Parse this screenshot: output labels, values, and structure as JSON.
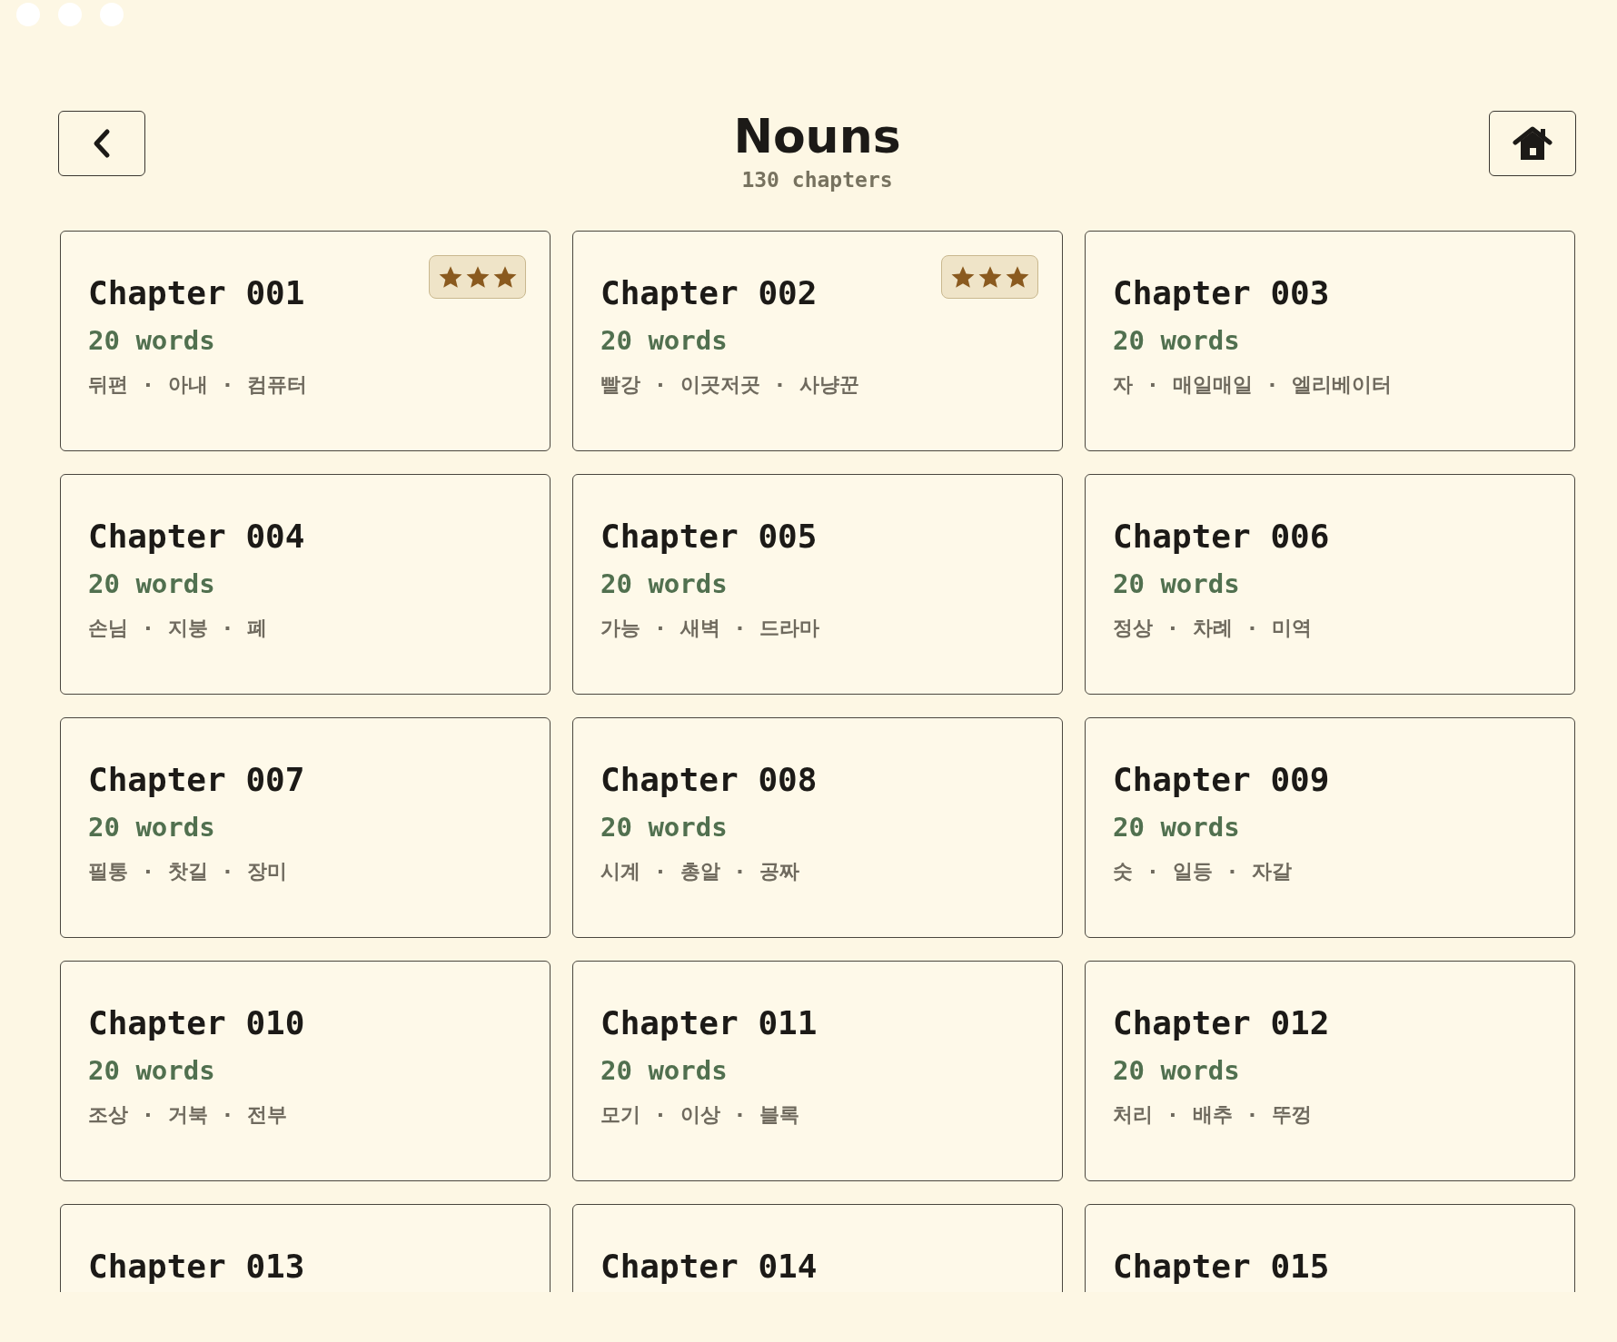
{
  "header": {
    "title": "Nouns",
    "subtitle": "130 chapters"
  },
  "chapters": [
    {
      "title": "Chapter 001",
      "count": "20 words",
      "preview": "뒤편 · 아내 · 컴퓨터",
      "stars": 3
    },
    {
      "title": "Chapter 002",
      "count": "20 words",
      "preview": "빨강 · 이곳저곳 · 사냥꾼",
      "stars": 3
    },
    {
      "title": "Chapter 003",
      "count": "20 words",
      "preview": "자 · 매일매일 · 엘리베이터"
    },
    {
      "title": "Chapter 004",
      "count": "20 words",
      "preview": "손님 · 지붕 · 폐"
    },
    {
      "title": "Chapter 005",
      "count": "20 words",
      "preview": "가능 · 새벽 · 드라마"
    },
    {
      "title": "Chapter 006",
      "count": "20 words",
      "preview": "정상 · 차례 · 미역"
    },
    {
      "title": "Chapter 007",
      "count": "20 words",
      "preview": "필통 · 찻길 · 장미"
    },
    {
      "title": "Chapter 008",
      "count": "20 words",
      "preview": "시계 · 총알 · 공짜"
    },
    {
      "title": "Chapter 009",
      "count": "20 words",
      "preview": "숫 · 일등 · 자갈"
    },
    {
      "title": "Chapter 010",
      "count": "20 words",
      "preview": "조상 · 거북 · 전부"
    },
    {
      "title": "Chapter 011",
      "count": "20 words",
      "preview": "모기 · 이상 · 블록"
    },
    {
      "title": "Chapter 012",
      "count": "20 words",
      "preview": "처리 · 배추 · 뚜껑"
    },
    {
      "title": "Chapter 013"
    },
    {
      "title": "Chapter 014"
    },
    {
      "title": "Chapter 015"
    }
  ]
}
